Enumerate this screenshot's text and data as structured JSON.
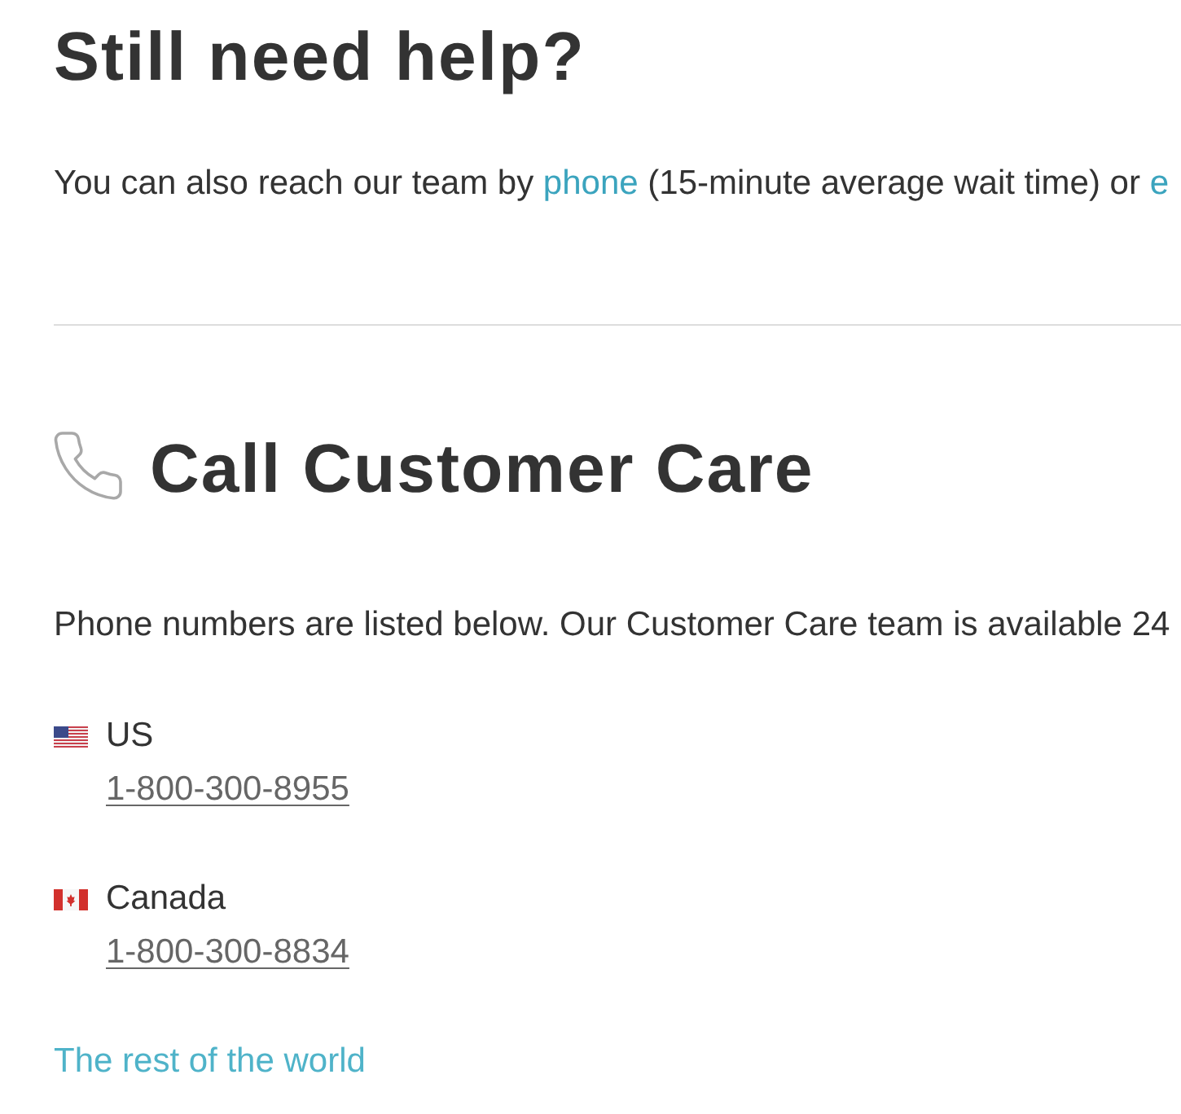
{
  "heading": "Still need help?",
  "intro": [
    {
      "kind": "text",
      "text": "You can also reach our team by"
    },
    {
      "kind": "link",
      "text": "phone"
    },
    {
      "kind": "text",
      "text": "(15-minute average wait time) or"
    },
    {
      "kind": "link",
      "text": "e"
    }
  ],
  "call_section": {
    "title": "Call Customer Care",
    "text": "Phone numbers are listed below. Our Customer Care team is available 24"
  },
  "numbers": [
    {
      "country": "US",
      "phone": "1-800-300-8955"
    },
    {
      "country": "Canada",
      "phone": "1-800-300-8834"
    }
  ],
  "other_link": "The rest of the world"
}
